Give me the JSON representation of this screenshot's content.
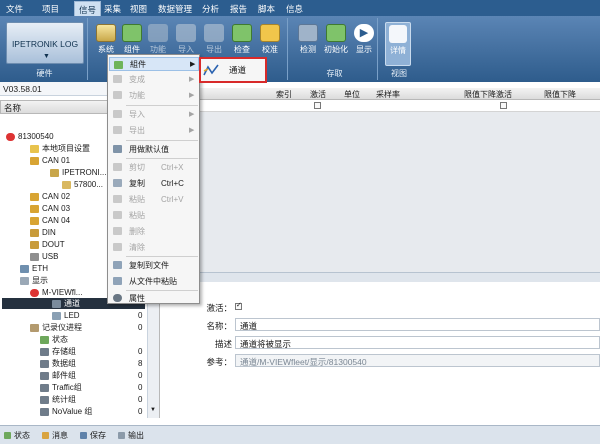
{
  "menubar": {
    "items": [
      "文件",
      "项目",
      "信号",
      "采集",
      "视图",
      "数据管理",
      "分析",
      "报告",
      "脚本",
      "信息"
    ],
    "active": "信号"
  },
  "ribbon": {
    "device": "IPETRONIK LOG",
    "hw_group": "硬件",
    "btn_system": "系统",
    "btn_component": "组件",
    "btn_function": "功能",
    "btn_import": "导入",
    "btn_export": "导出",
    "btn_check": "检查",
    "btn_verify": "校准",
    "btn_detect": "检测",
    "btn_init": "初始化",
    "btn_show": "显示",
    "btn_details": "详情",
    "save_group": "存取",
    "view_group": "视图"
  },
  "version": "V03.58.01",
  "tree": {
    "header": "名称",
    "nodes": [
      "81300540",
      "本地项目设置",
      "CAN 01",
      "IPETRONI...",
      "57800...",
      "CAN 02",
      "CAN 03",
      "CAN 04",
      "DIN",
      "DOUT",
      "USB",
      "ETH",
      "显示",
      "M-VIEWfl...",
      "通道",
      "LED",
      "记录仪进程",
      "状态",
      "存储组",
      "数据组",
      "邮件组",
      "Traffic组",
      "统计组",
      "NoValue 组"
    ],
    "values": [
      "0",
      "0",
      "0",
      "8",
      "0",
      "0",
      "0",
      "0"
    ]
  },
  "grid": {
    "columns": [
      "索引",
      "激活",
      "单位",
      "采样率",
      "限值下降激活",
      "限值下降"
    ]
  },
  "props": {
    "active_label": "激活：",
    "name_label": "名称：",
    "name_value": "通道",
    "desc_label": "描述",
    "desc_value": "通道将被显示",
    "ref_label": "参考：",
    "ref_value": "通道/M-VIEWfleet/显示/81300540"
  },
  "context_menu": {
    "items": [
      {
        "label": "組件",
        "arrow": "▶"
      },
      {
        "label": "变成",
        "arrow": "▶"
      },
      {
        "label": "功能",
        "arrow": "▶"
      },
      {
        "label": "导入",
        "arrow": "▶"
      },
      {
        "label": "导出",
        "arrow": "▶"
      },
      {
        "label": "用做默认值"
      },
      {
        "label": "剪切",
        "shortcut": "Ctrl+X"
      },
      {
        "label": "复制",
        "shortcut": "Ctrl+C"
      },
      {
        "label": "粘贴",
        "shortcut": "Ctrl+V"
      },
      {
        "label": "粘贴"
      },
      {
        "label": "删除"
      },
      {
        "label": "清除"
      },
      {
        "label": "复制到文件"
      },
      {
        "label": "从文件中粘贴"
      },
      {
        "label": "属性"
      }
    ]
  },
  "submenu": {
    "label": "通道"
  },
  "bottom_tabs": [
    "状态",
    "消息",
    "保存",
    "输出"
  ],
  "colors": {
    "accent": "#2c5d8f",
    "highlight_border": "#d82a2a",
    "selection": "#25313f"
  }
}
